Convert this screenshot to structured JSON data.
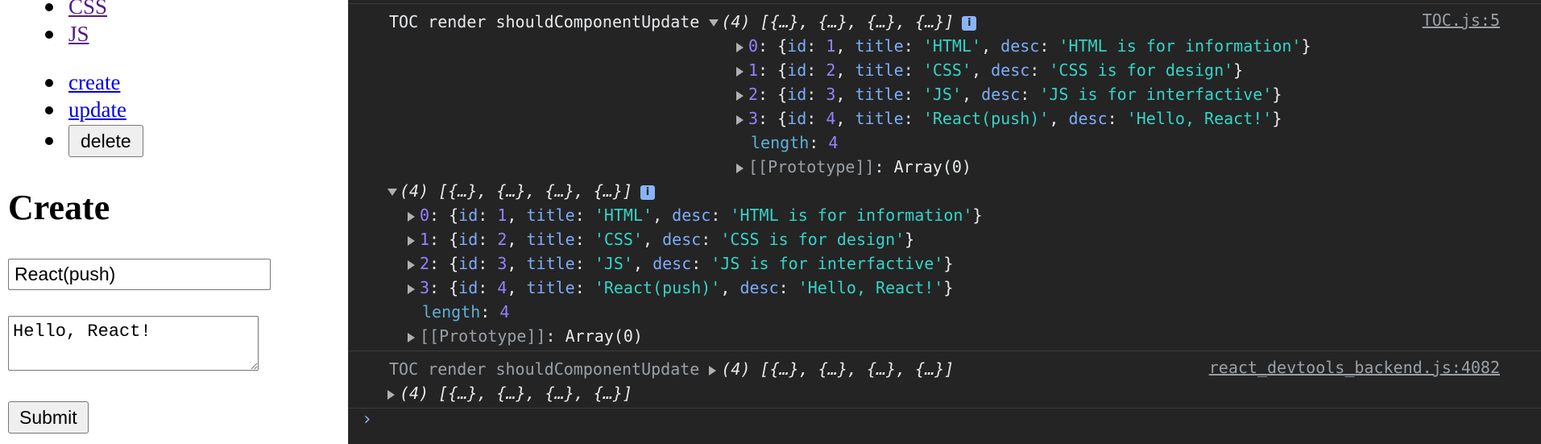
{
  "page": {
    "nav_items": [
      "CSS",
      "JS"
    ],
    "actions": {
      "create": "create",
      "update": "update",
      "delete": "delete"
    },
    "heading": "Create",
    "title_value": "React(push)",
    "desc_value": "Hello, React!",
    "submit_label": "Submit"
  },
  "console": {
    "group1": {
      "label": "TOC render shouldComponentUpdate",
      "summary": "(4) [{…}, {…}, {…}, {…}]",
      "source": "TOC.js:5",
      "items": [
        {
          "index": "0",
          "id": "1",
          "title": "'HTML'",
          "desc": "'HTML is for information'"
        },
        {
          "index": "1",
          "id": "2",
          "title": "'CSS'",
          "desc": "'CSS is for design'"
        },
        {
          "index": "2",
          "id": "3",
          "title": "'JS'",
          "desc": "'JS is for interfactive'"
        },
        {
          "index": "3",
          "id": "4",
          "title": "'React(push)'",
          "desc": "'Hello, React!'"
        }
      ],
      "length_label": "length",
      "length_value": "4",
      "prototype": "[[Prototype]]",
      "prototype_value": "Array(0)"
    },
    "group2": {
      "summary": "(4) [{…}, {…}, {…}, {…}]",
      "items": [
        {
          "index": "0",
          "id": "1",
          "title": "'HTML'",
          "desc": "'HTML is for information'"
        },
        {
          "index": "1",
          "id": "2",
          "title": "'CSS'",
          "desc": "'CSS is for design'"
        },
        {
          "index": "2",
          "id": "3",
          "title": "'JS'",
          "desc": "'JS is for interfactive'"
        },
        {
          "index": "3",
          "id": "4",
          "title": "'React(push)'",
          "desc": "'Hello, React!'"
        }
      ],
      "length_label": "length",
      "length_value": "4",
      "prototype": "[[Prototype]]",
      "prototype_value": "Array(0)"
    },
    "entry3": {
      "label": "TOC render shouldComponentUpdate",
      "summary": "(4) [{…}, {…}, {…}, {…}]",
      "source": "react_devtools_backend.js:4082",
      "summary2": "(4) [{…}, {…}, {…}, {…}]"
    },
    "info_glyph": "i",
    "prompt_glyph": "›"
  }
}
